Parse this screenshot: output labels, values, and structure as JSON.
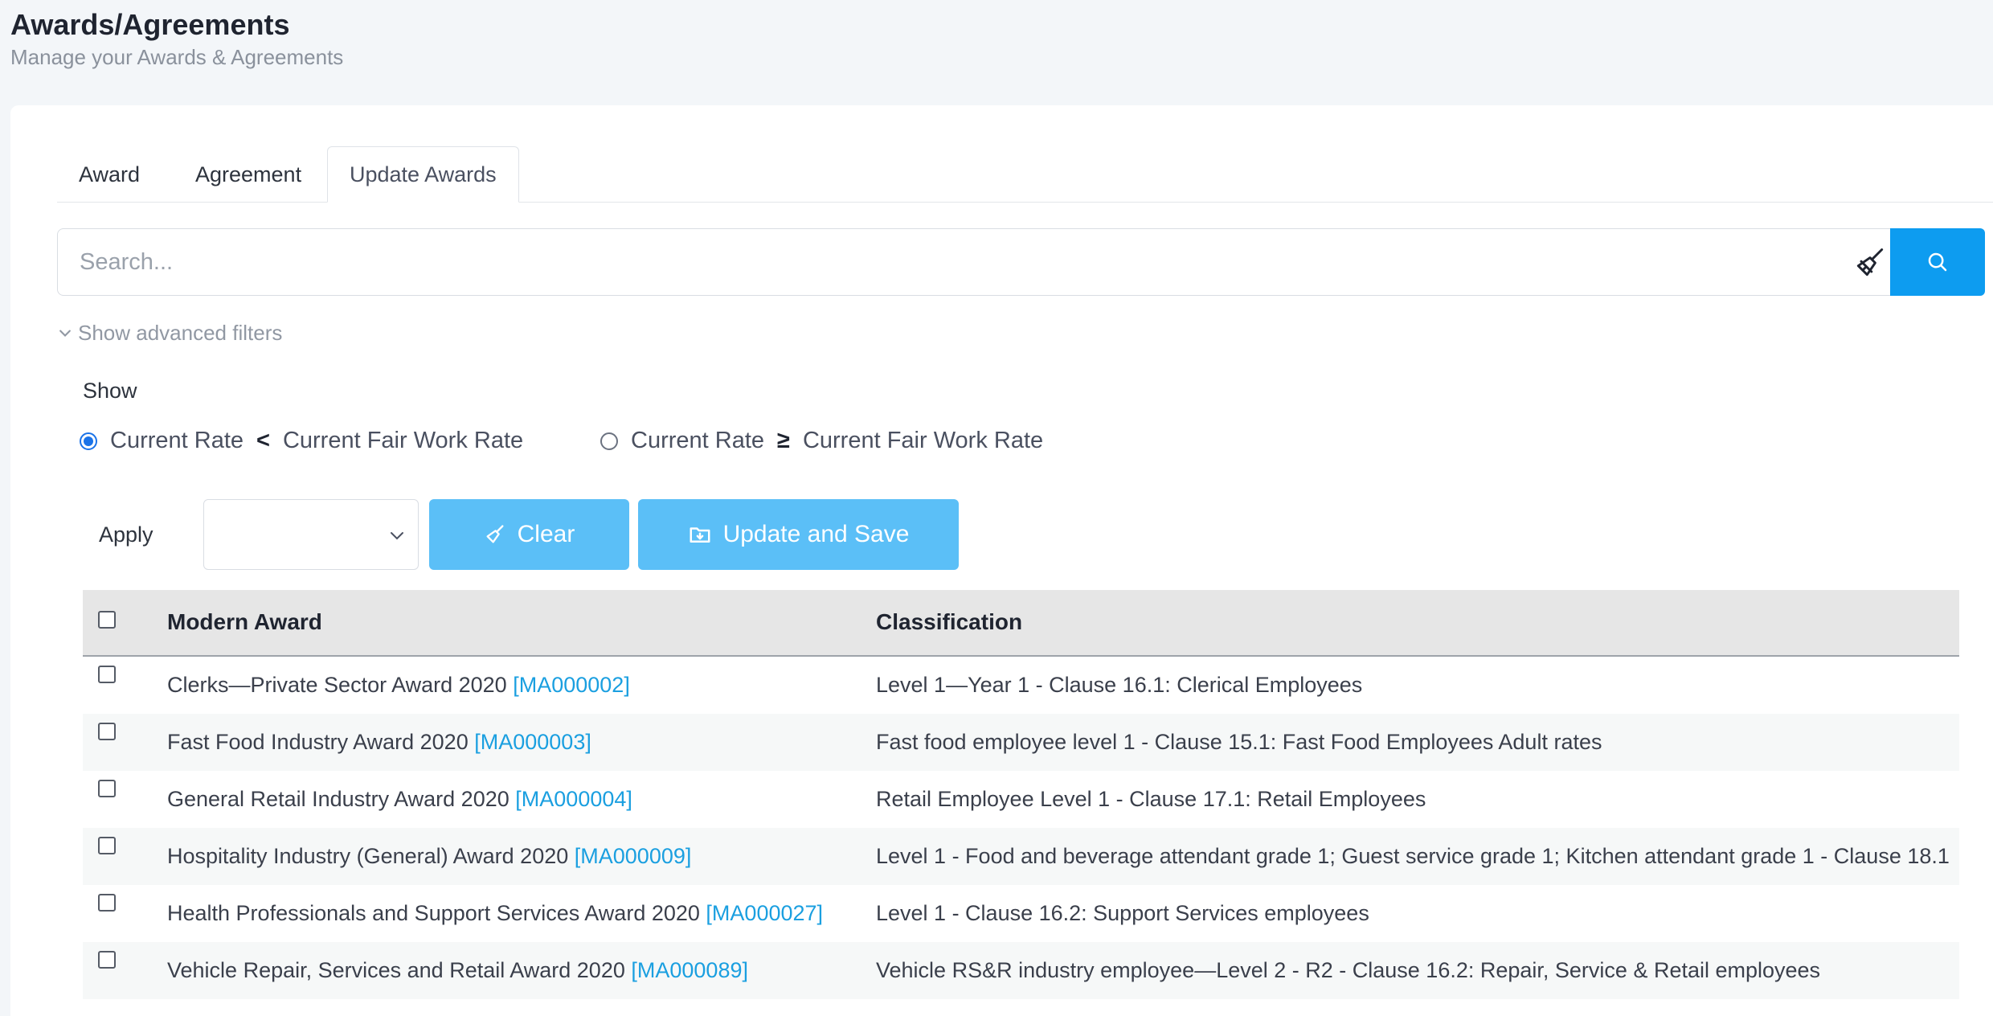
{
  "header": {
    "title": "Awards/Agreements",
    "subtitle": "Manage your Awards & Agreements"
  },
  "tabs": [
    {
      "label": "Award"
    },
    {
      "label": "Agreement"
    },
    {
      "label": "Update Awards",
      "active": true
    }
  ],
  "search": {
    "placeholder": "Search...",
    "clear_icon": "broom-icon",
    "submit_icon": "search-icon"
  },
  "filters": {
    "advanced_label": "Show advanced filters",
    "show_label": "Show",
    "options": [
      {
        "left": "Current Rate",
        "operator": "<",
        "right": "Current Fair Work Rate",
        "selected": true
      },
      {
        "left": "Current Rate",
        "operator": "≥",
        "right": "Current Fair Work Rate",
        "selected": false
      }
    ]
  },
  "apply": {
    "label": "Apply",
    "selected_value": "",
    "clear_label": "Clear",
    "save_label": "Update and Save"
  },
  "table": {
    "columns": [
      "Modern Award",
      "Classification"
    ],
    "rows": [
      {
        "award": "Clerks—Private Sector Award 2020",
        "code": "[MA000002]",
        "classification": "Level 1—Year 1 - Clause 16.1: Clerical Employees"
      },
      {
        "award": "Fast Food Industry Award 2020",
        "code": "[MA000003]",
        "classification": "Fast food employee level 1 - Clause 15.1: Fast Food Employees Adult rates"
      },
      {
        "award": "General Retail Industry Award 2020",
        "code": "[MA000004]",
        "classification": "Retail Employee Level 1 - Clause 17.1: Retail Employees"
      },
      {
        "award": "Hospitality Industry (General) Award 2020",
        "code": "[MA000009]",
        "classification": "Level 1 - Food and beverage attendant grade 1; Guest service grade 1; Kitchen attendant grade 1 - Clause 18.1"
      },
      {
        "award": "Health Professionals and Support Services Award 2020",
        "code": "[MA000027]",
        "classification": "Level 1 - Clause 16.2: Support Services employees"
      },
      {
        "award": "Vehicle Repair, Services and Retail Award 2020",
        "code": "[MA000089]",
        "classification": "Vehicle RS&R industry employee—Level 2 - R2 - Clause 16.2: Repair, Service & Retail employees"
      }
    ]
  },
  "colors": {
    "primary": "#0d9cf0",
    "button_light": "#5bbff7",
    "link": "#1a9fe0",
    "header_bg": "#e6e6e6"
  }
}
